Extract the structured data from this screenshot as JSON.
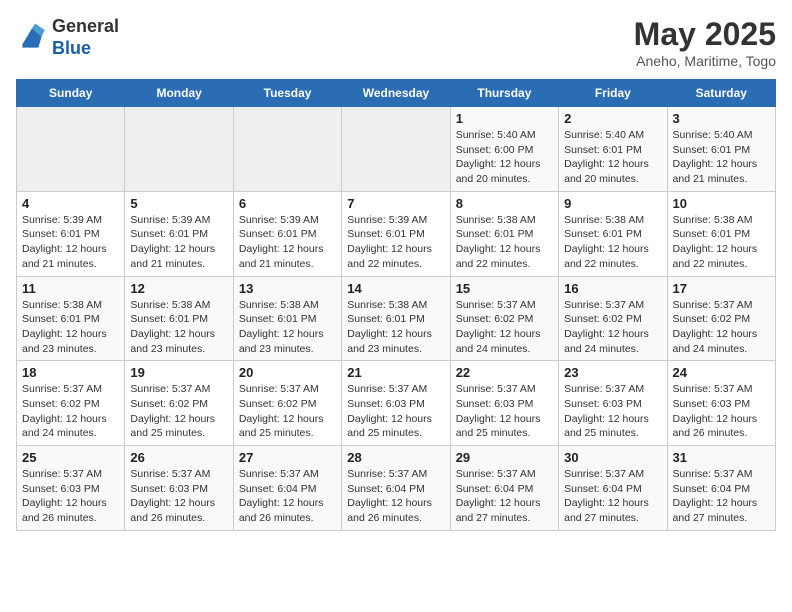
{
  "header": {
    "logo_line1": "General",
    "logo_line2": "Blue",
    "title": "May 2025",
    "subtitle": "Aneho, Maritime, Togo"
  },
  "weekdays": [
    "Sunday",
    "Monday",
    "Tuesday",
    "Wednesday",
    "Thursday",
    "Friday",
    "Saturday"
  ],
  "weeks": [
    [
      {
        "day": "",
        "info": ""
      },
      {
        "day": "",
        "info": ""
      },
      {
        "day": "",
        "info": ""
      },
      {
        "day": "",
        "info": ""
      },
      {
        "day": "1",
        "info": "Sunrise: 5:40 AM\nSunset: 6:00 PM\nDaylight: 12 hours and 20 minutes."
      },
      {
        "day": "2",
        "info": "Sunrise: 5:40 AM\nSunset: 6:01 PM\nDaylight: 12 hours and 20 minutes."
      },
      {
        "day": "3",
        "info": "Sunrise: 5:40 AM\nSunset: 6:01 PM\nDaylight: 12 hours and 21 minutes."
      }
    ],
    [
      {
        "day": "4",
        "info": "Sunrise: 5:39 AM\nSunset: 6:01 PM\nDaylight: 12 hours and 21 minutes."
      },
      {
        "day": "5",
        "info": "Sunrise: 5:39 AM\nSunset: 6:01 PM\nDaylight: 12 hours and 21 minutes."
      },
      {
        "day": "6",
        "info": "Sunrise: 5:39 AM\nSunset: 6:01 PM\nDaylight: 12 hours and 21 minutes."
      },
      {
        "day": "7",
        "info": "Sunrise: 5:39 AM\nSunset: 6:01 PM\nDaylight: 12 hours and 22 minutes."
      },
      {
        "day": "8",
        "info": "Sunrise: 5:38 AM\nSunset: 6:01 PM\nDaylight: 12 hours and 22 minutes."
      },
      {
        "day": "9",
        "info": "Sunrise: 5:38 AM\nSunset: 6:01 PM\nDaylight: 12 hours and 22 minutes."
      },
      {
        "day": "10",
        "info": "Sunrise: 5:38 AM\nSunset: 6:01 PM\nDaylight: 12 hours and 22 minutes."
      }
    ],
    [
      {
        "day": "11",
        "info": "Sunrise: 5:38 AM\nSunset: 6:01 PM\nDaylight: 12 hours and 23 minutes."
      },
      {
        "day": "12",
        "info": "Sunrise: 5:38 AM\nSunset: 6:01 PM\nDaylight: 12 hours and 23 minutes."
      },
      {
        "day": "13",
        "info": "Sunrise: 5:38 AM\nSunset: 6:01 PM\nDaylight: 12 hours and 23 minutes."
      },
      {
        "day": "14",
        "info": "Sunrise: 5:38 AM\nSunset: 6:01 PM\nDaylight: 12 hours and 23 minutes."
      },
      {
        "day": "15",
        "info": "Sunrise: 5:37 AM\nSunset: 6:02 PM\nDaylight: 12 hours and 24 minutes."
      },
      {
        "day": "16",
        "info": "Sunrise: 5:37 AM\nSunset: 6:02 PM\nDaylight: 12 hours and 24 minutes."
      },
      {
        "day": "17",
        "info": "Sunrise: 5:37 AM\nSunset: 6:02 PM\nDaylight: 12 hours and 24 minutes."
      }
    ],
    [
      {
        "day": "18",
        "info": "Sunrise: 5:37 AM\nSunset: 6:02 PM\nDaylight: 12 hours and 24 minutes."
      },
      {
        "day": "19",
        "info": "Sunrise: 5:37 AM\nSunset: 6:02 PM\nDaylight: 12 hours and 25 minutes."
      },
      {
        "day": "20",
        "info": "Sunrise: 5:37 AM\nSunset: 6:02 PM\nDaylight: 12 hours and 25 minutes."
      },
      {
        "day": "21",
        "info": "Sunrise: 5:37 AM\nSunset: 6:03 PM\nDaylight: 12 hours and 25 minutes."
      },
      {
        "day": "22",
        "info": "Sunrise: 5:37 AM\nSunset: 6:03 PM\nDaylight: 12 hours and 25 minutes."
      },
      {
        "day": "23",
        "info": "Sunrise: 5:37 AM\nSunset: 6:03 PM\nDaylight: 12 hours and 25 minutes."
      },
      {
        "day": "24",
        "info": "Sunrise: 5:37 AM\nSunset: 6:03 PM\nDaylight: 12 hours and 26 minutes."
      }
    ],
    [
      {
        "day": "25",
        "info": "Sunrise: 5:37 AM\nSunset: 6:03 PM\nDaylight: 12 hours and 26 minutes."
      },
      {
        "day": "26",
        "info": "Sunrise: 5:37 AM\nSunset: 6:03 PM\nDaylight: 12 hours and 26 minutes."
      },
      {
        "day": "27",
        "info": "Sunrise: 5:37 AM\nSunset: 6:04 PM\nDaylight: 12 hours and 26 minutes."
      },
      {
        "day": "28",
        "info": "Sunrise: 5:37 AM\nSunset: 6:04 PM\nDaylight: 12 hours and 26 minutes."
      },
      {
        "day": "29",
        "info": "Sunrise: 5:37 AM\nSunset: 6:04 PM\nDaylight: 12 hours and 27 minutes."
      },
      {
        "day": "30",
        "info": "Sunrise: 5:37 AM\nSunset: 6:04 PM\nDaylight: 12 hours and 27 minutes."
      },
      {
        "day": "31",
        "info": "Sunrise: 5:37 AM\nSunset: 6:04 PM\nDaylight: 12 hours and 27 minutes."
      }
    ]
  ]
}
